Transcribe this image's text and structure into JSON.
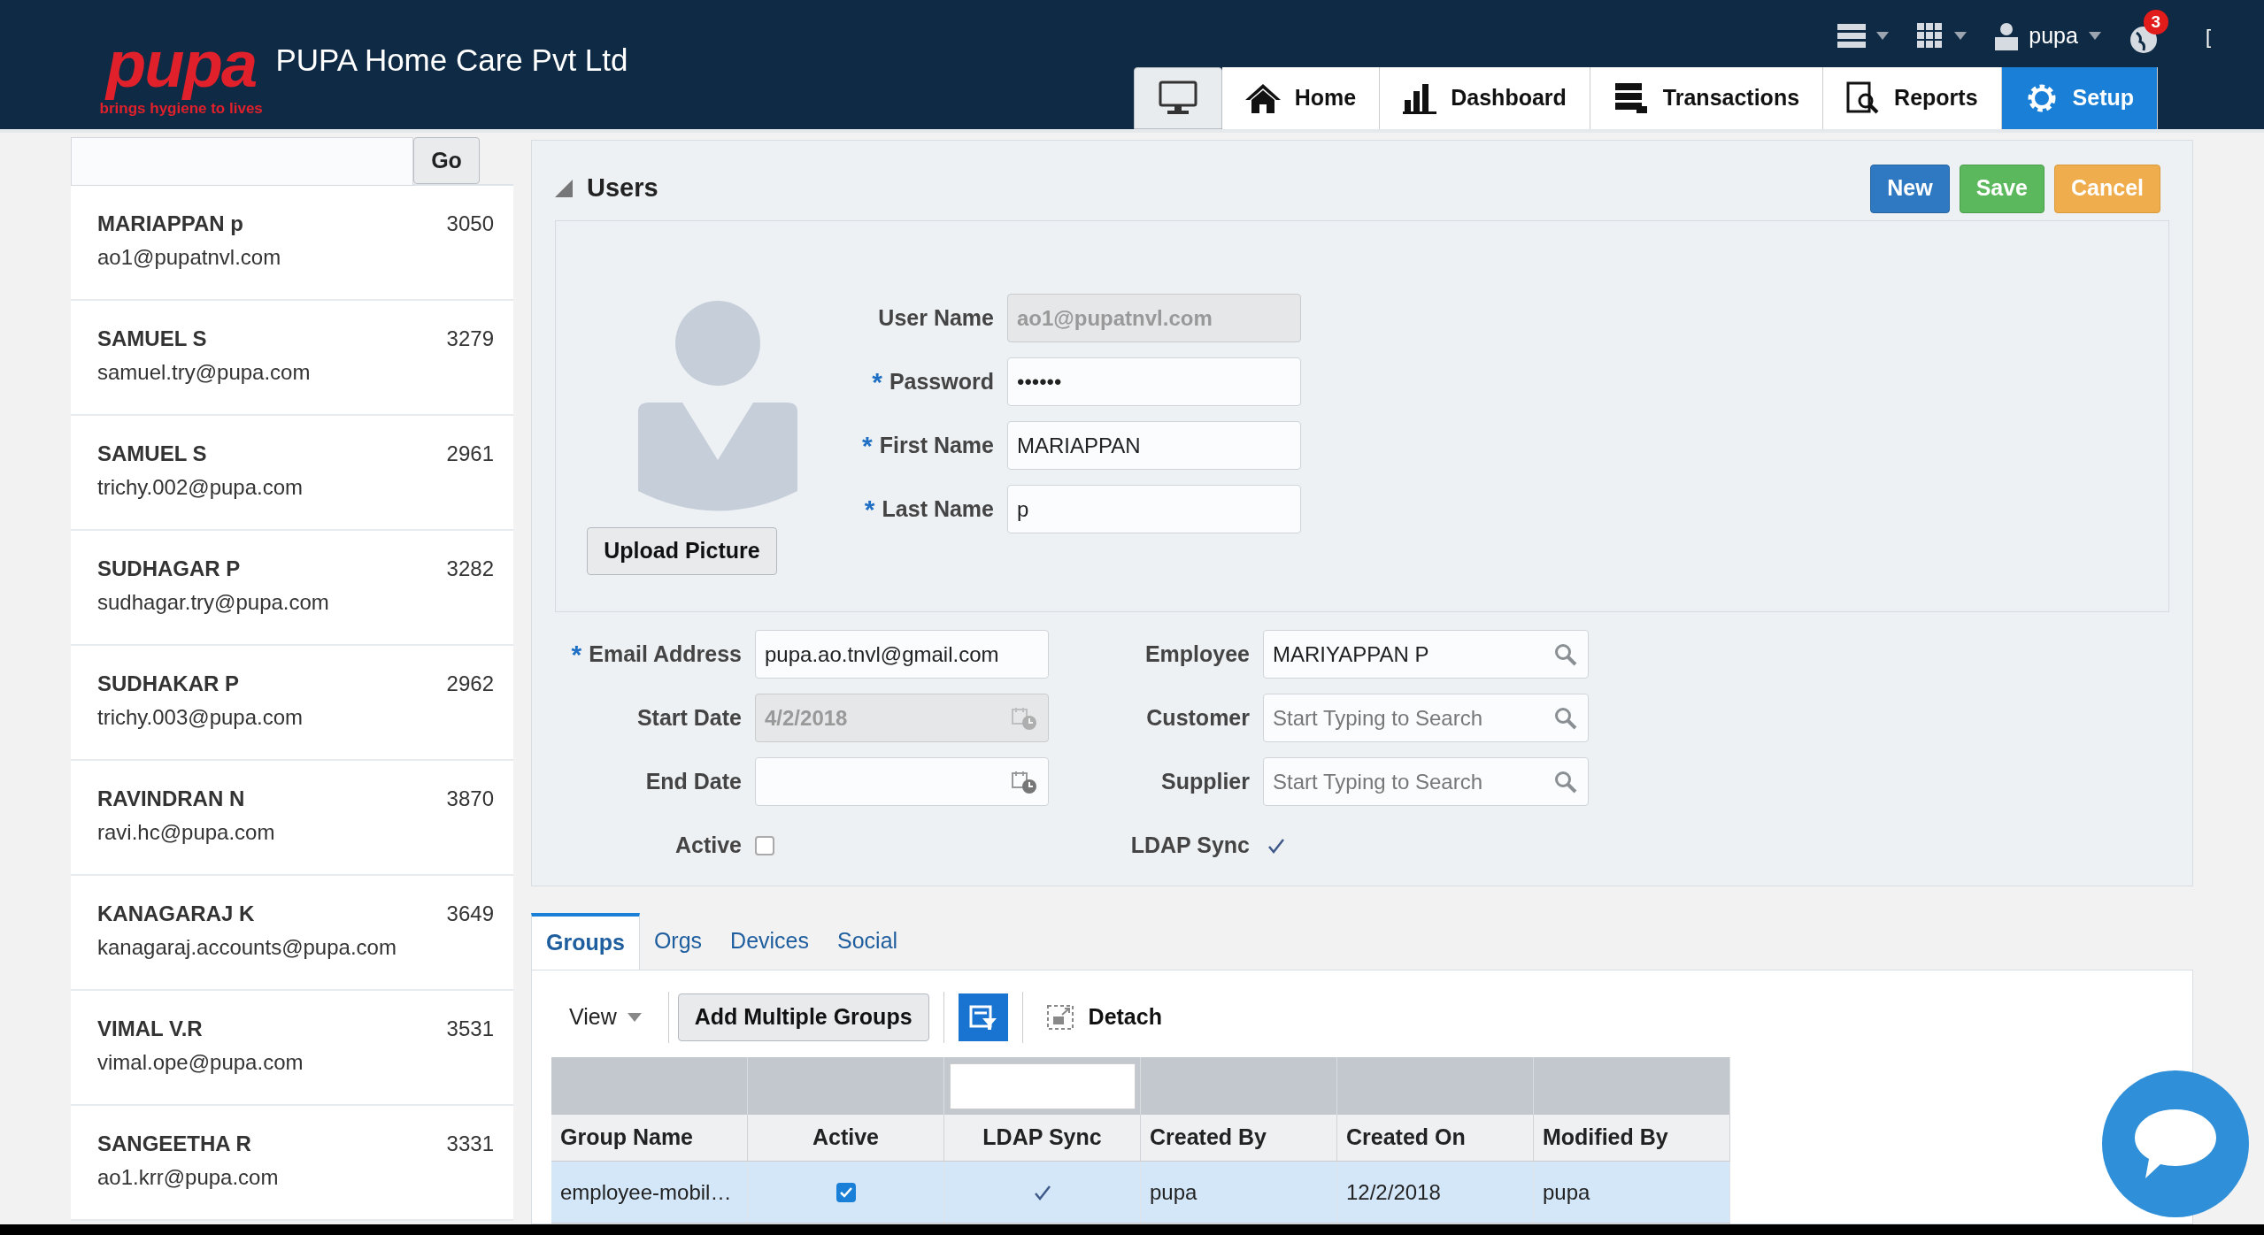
{
  "header": {
    "logo_text": "pupa",
    "logo_tagline": "brings hygiene to lives",
    "company": "PUPA Home Care Pvt Ltd",
    "top_bar": {
      "user": "pupa",
      "notifications": "3",
      "cut_glyph": "["
    },
    "nav": [
      {
        "kind": "monitor",
        "selected": false
      },
      {
        "kind": "home",
        "label": "Home",
        "selected": false
      },
      {
        "kind": "chart",
        "label": "Dashboard",
        "selected": false
      },
      {
        "kind": "stack",
        "label": "Transactions",
        "selected": false
      },
      {
        "kind": "report",
        "label": "Reports",
        "selected": false
      },
      {
        "kind": "gear",
        "label": "Setup",
        "selected": true
      }
    ]
  },
  "sidebar": {
    "search": {
      "button": "Go"
    },
    "items": [
      {
        "name": "MARIAPPAN p",
        "email": "ao1@pupatnvl.com",
        "number": "3050"
      },
      {
        "name": "SAMUEL S",
        "email": "samuel.try@pupa.com",
        "number": "3279"
      },
      {
        "name": "SAMUEL S",
        "email": "trichy.002@pupa.com",
        "number": "2961"
      },
      {
        "name": "SUDHAGAR P",
        "email": "sudhagar.try@pupa.com",
        "number": "3282"
      },
      {
        "name": "SUDHAKAR P",
        "email": "trichy.003@pupa.com",
        "number": "2962"
      },
      {
        "name": "RAVINDRAN N",
        "email": "ravi.hc@pupa.com",
        "number": "3870"
      },
      {
        "name": "KANAGARAJ K",
        "email": "kanagaraj.accounts@pupa.com",
        "number": "3649"
      },
      {
        "name": "VIMAL V.R",
        "email": "vimal.ope@pupa.com",
        "number": "3531"
      },
      {
        "name": "SANGEETHA R",
        "email": "ao1.krr@pupa.com",
        "number": "3331"
      }
    ]
  },
  "form": {
    "title": "Users",
    "buttons": [
      {
        "label": "New",
        "kind": "primary"
      },
      {
        "label": "Save",
        "kind": "success"
      },
      {
        "label": "Cancel",
        "kind": "warning"
      }
    ],
    "upload_button": "Upload Picture",
    "account_fields": [
      {
        "label": "User Name",
        "kind": "text",
        "disabled": true,
        "value": "ao1@pupatnvl.com"
      },
      {
        "label": "Password",
        "required_mark": "*",
        "kind": "text",
        "disabled": false,
        "value": "••••••"
      },
      {
        "label": "First Name",
        "required_mark": "*",
        "kind": "text",
        "disabled": false,
        "value": "MARIAPPAN"
      },
      {
        "label": "Last Name",
        "required_mark": "*",
        "kind": "text",
        "disabled": false,
        "value": "p"
      }
    ],
    "left_fields": [
      {
        "label": "Email Address",
        "required_mark": "*",
        "kind": "text",
        "disabled": false,
        "value": "pupa.ao.tnvl@gmail.com"
      },
      {
        "label": "Start Date",
        "kind": "date",
        "disabled": true,
        "value": "4/2/2018"
      },
      {
        "label": "End Date",
        "kind": "date",
        "disabled": false
      },
      {
        "label": "Active",
        "kind": "checkbox",
        "checked": false
      }
    ],
    "right_fields": [
      {
        "label": "Employee",
        "kind": "lookup",
        "value": "MARIYAPPAN P"
      },
      {
        "label": "Customer",
        "kind": "lookup",
        "placeholder": "Start Typing to Search"
      },
      {
        "label": "Supplier",
        "kind": "lookup",
        "placeholder": "Start Typing to Search"
      },
      {
        "label": "LDAP Sync",
        "kind": "tick",
        "checked": true
      }
    ]
  },
  "tabs": [
    {
      "label": "Groups",
      "selected": true
    },
    {
      "label": "Orgs",
      "selected": false
    },
    {
      "label": "Devices",
      "selected": false
    },
    {
      "label": "Social",
      "selected": false
    }
  ],
  "toolbar": {
    "view": "View",
    "add_button": "Add Multiple Groups",
    "detach": "Detach"
  },
  "table": {
    "columns": [
      "Group Name",
      "Active",
      "LDAP Sync",
      "Created By",
      "Created On",
      "Modified By"
    ],
    "rows": [
      {
        "selected": true,
        "cells": [
          {
            "kind": "text",
            "text": "employee-mobil…"
          },
          {
            "kind": "checkbox",
            "checked": true
          },
          {
            "kind": "tick",
            "checked": true
          },
          {
            "kind": "text",
            "text": "pupa"
          },
          {
            "kind": "text",
            "text": "12/2/2018"
          },
          {
            "kind": "text",
            "text": "pupa"
          }
        ]
      }
    ]
  }
}
